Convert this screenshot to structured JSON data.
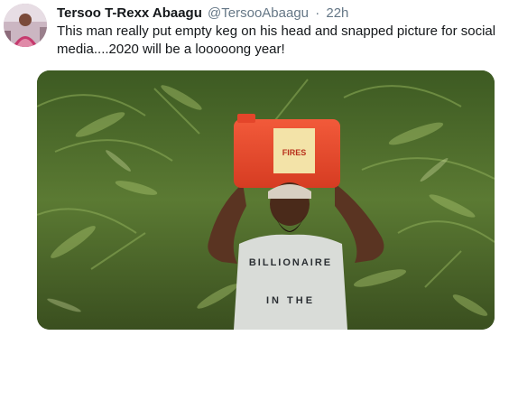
{
  "tweet": {
    "display_name": "Tersoo T-Rexx Abaagu",
    "handle": "@TersooAbaagu",
    "separator": "·",
    "time": "22h",
    "text": "This man really put empty keg on his head and snapped picture for social media....2020 will be a looooong year!"
  },
  "media": {
    "shirt_line1": "BILLIONAIRE",
    "shirt_line2": "IN THE",
    "keg_label": "FIRES"
  },
  "colors": {
    "name": "#14171a",
    "meta": "#657786",
    "keg": "#e8452b",
    "foliage": "#4f6e2a"
  },
  "icons": {
    "avatar": "profile-photo"
  }
}
